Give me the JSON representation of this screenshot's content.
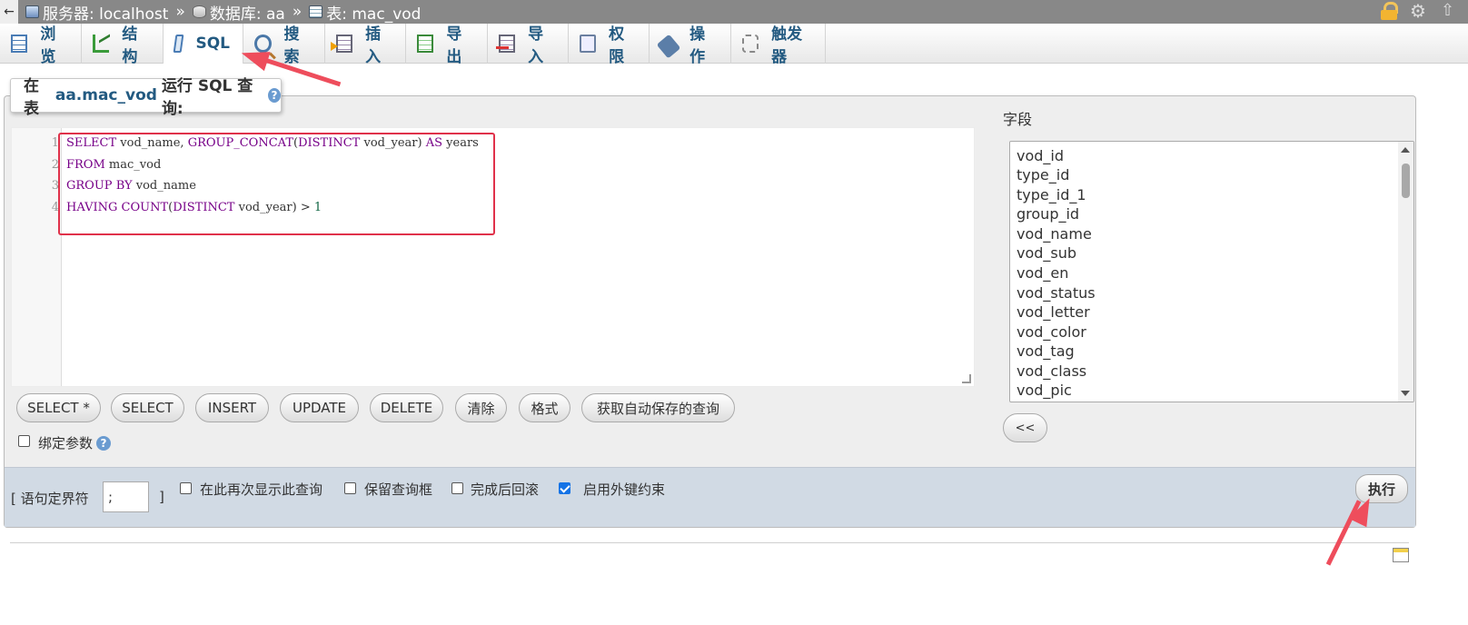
{
  "topbar": {
    "back_glyph": "←",
    "server_label": "服务器: localhost",
    "db_label": "数据库: aa",
    "table_label": "表: mac_vod",
    "sep": "»"
  },
  "tabs": [
    {
      "label": "浏览",
      "icon": "browse-icon"
    },
    {
      "label": "结构",
      "icon": "structure-icon"
    },
    {
      "label": "SQL",
      "icon": "sql-icon",
      "active": true
    },
    {
      "label": "搜索",
      "icon": "search-icon"
    },
    {
      "label": "插入",
      "icon": "insert-icon"
    },
    {
      "label": "导出",
      "icon": "export-icon"
    },
    {
      "label": "导入",
      "icon": "import-icon"
    },
    {
      "label": "权限",
      "icon": "privileges-icon"
    },
    {
      "label": "操作",
      "icon": "operations-icon"
    },
    {
      "label": "触发器",
      "icon": "triggers-icon"
    }
  ],
  "query_box": {
    "prefix": "在表",
    "table": "aa.mac_vod",
    "suffix": "运行 SQL 查询:"
  },
  "editor": {
    "line_numbers": [
      "1",
      "2",
      "3",
      "4"
    ],
    "lines": [
      "SELECT vod_name, GROUP_CONCAT(DISTINCT vod_year) AS years",
      "FROM mac_vod",
      "GROUP BY vod_name",
      "HAVING COUNT(DISTINCT vod_year) > 1"
    ]
  },
  "buttons": {
    "select_star": "SELECT *",
    "select": "SELECT",
    "insert": "INSERT",
    "update": "UPDATE",
    "delete": "DELETE",
    "clear": "清除",
    "format": "格式",
    "autosave": "获取自动保存的查询",
    "insert_field": "<<",
    "go": "执行"
  },
  "bind_params": {
    "label": "绑定参数",
    "checked": false
  },
  "fields": {
    "label": "字段",
    "items": [
      "vod_id",
      "type_id",
      "type_id_1",
      "group_id",
      "vod_name",
      "vod_sub",
      "vod_en",
      "vod_status",
      "vod_letter",
      "vod_color",
      "vod_tag",
      "vod_class",
      "vod_pic"
    ]
  },
  "footer": {
    "delimiter_label_open": "[ 语句定界符",
    "delimiter_value": ";",
    "delimiter_label_close": "]",
    "options": [
      {
        "label": "在此再次显示此查询",
        "checked": false
      },
      {
        "label": "保留查询框",
        "checked": false
      },
      {
        "label": "完成后回滚",
        "checked": false
      },
      {
        "label": "启用外键约束",
        "checked": true
      }
    ]
  },
  "colors": {
    "accent": "#235a81",
    "annotation": "#ee4d5c",
    "highlight_border": "#e0314a"
  }
}
